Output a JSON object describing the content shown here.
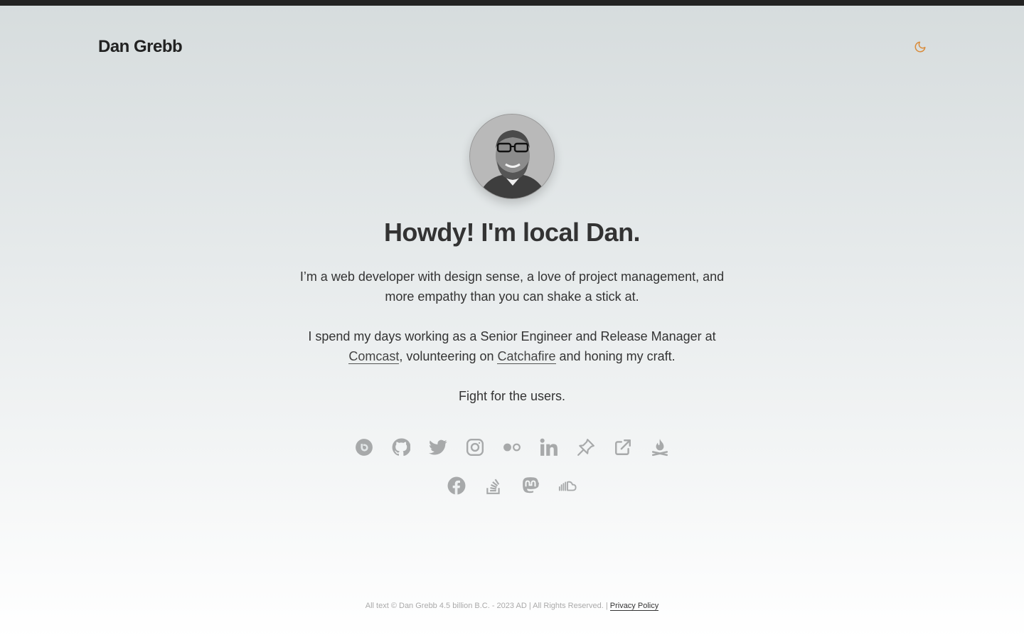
{
  "header": {
    "site_title": "Dan Grebb",
    "theme_toggle_icon": "moon-icon",
    "accent_color": "#d98b3a"
  },
  "hero": {
    "title": "Howdy! I'm local Dan.",
    "para1": "I’m a web developer with design sense, a love of project management, and more empathy than you can shake a stick at.",
    "para2_prefix": "I spend my days working as a Senior Engineer and Release Manager at ",
    "para2_link1": "Comcast",
    "para2_middle": ", volunteering on ",
    "para2_link2": "Catchafire",
    "para2_suffix": " and honing my craft.",
    "para3": "Fight for the users."
  },
  "social": {
    "row1": [
      "gravatar-icon",
      "github-icon",
      "twitter-icon",
      "instagram-icon",
      "flickr-icon",
      "linkedin-icon",
      "pinboard-icon",
      "external-link-icon",
      "campfire-icon"
    ],
    "row2": [
      "facebook-icon",
      "stackoverflow-icon",
      "mastodon-icon",
      "soundcloud-icon"
    ],
    "icon_color": "#a7a9aa"
  },
  "footer": {
    "copyright": "All text © Dan Grebb 4.5 billion B.C. - 2023 AD | All Rights Reserved. | ",
    "privacy_link": "Privacy Policy"
  }
}
